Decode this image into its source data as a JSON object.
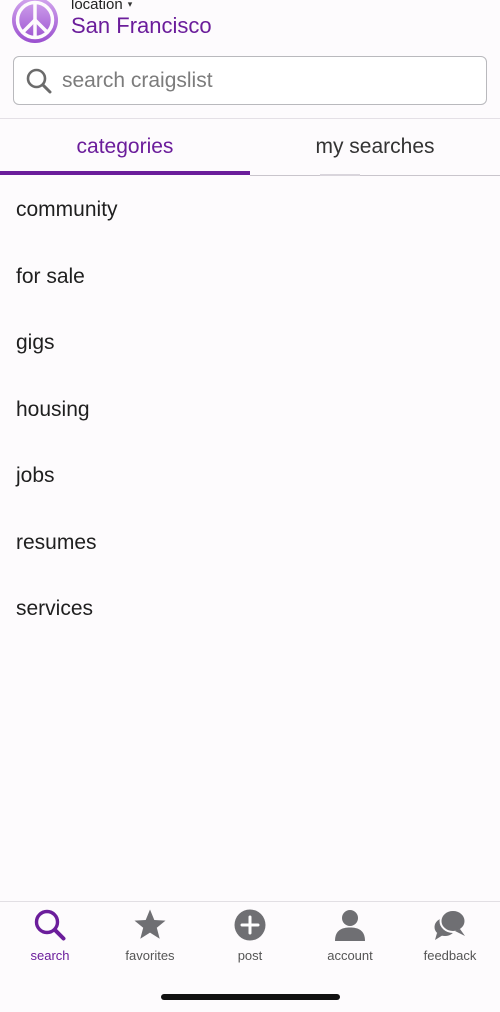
{
  "header": {
    "location_label": "location",
    "location_caret": "▾",
    "city": "San Francisco"
  },
  "search": {
    "placeholder": "search craigslist",
    "value": ""
  },
  "tabs": [
    {
      "label": "categories",
      "active": true
    },
    {
      "label": "my searches",
      "active": false
    }
  ],
  "categories": [
    "community",
    "for sale",
    "gigs",
    "housing",
    "jobs",
    "resumes",
    "services"
  ],
  "tabbar": {
    "items": [
      {
        "label": "search",
        "icon": "search-icon",
        "active": true
      },
      {
        "label": "favorites",
        "icon": "star-icon",
        "active": false
      },
      {
        "label": "post",
        "icon": "plus-circle-icon",
        "active": false
      },
      {
        "label": "account",
        "icon": "person-icon",
        "active": false
      },
      {
        "label": "feedback",
        "icon": "chat-bubbles-icon",
        "active": false
      }
    ]
  },
  "colors": {
    "accent": "#6b1d9b",
    "logo_light": "#c99ee6",
    "icon_gray": "#6f6f73"
  }
}
